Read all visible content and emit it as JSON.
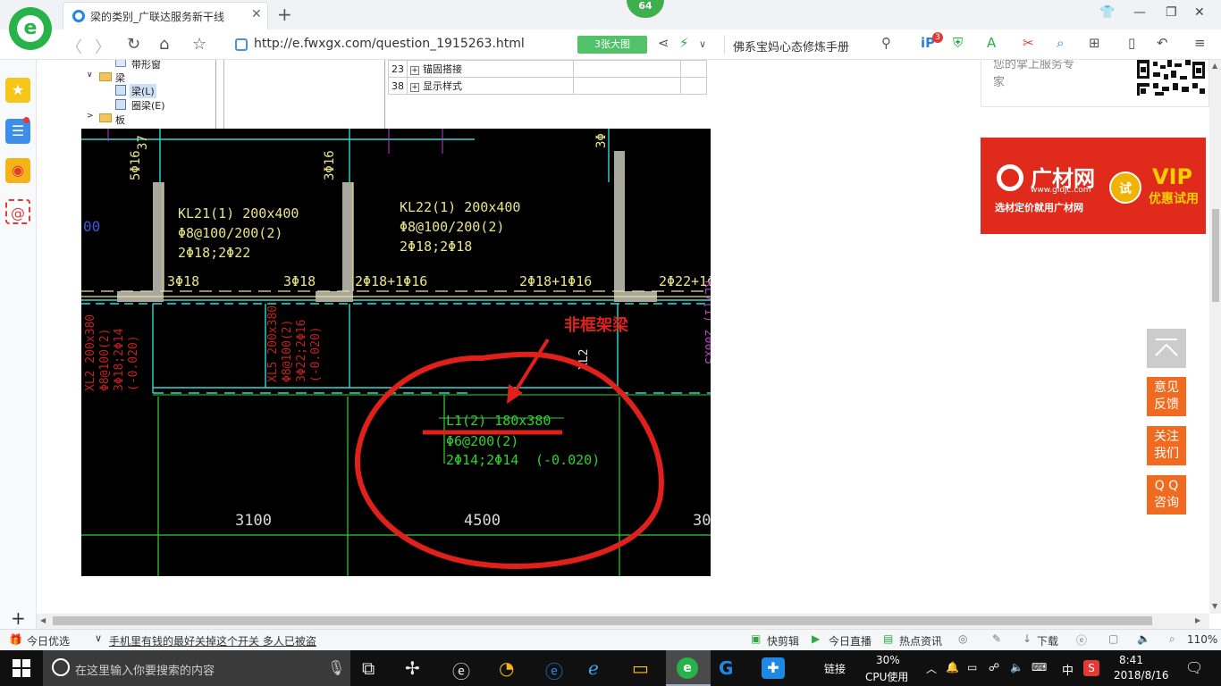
{
  "browser": {
    "tab_title": "梁的类别_广联达服务新干线",
    "tab_close": "✕",
    "new_tab": "+",
    "badge_count": "64",
    "url": "http://e.fwxgx.com/question_1915263.html",
    "big_pic_button": "3张大图",
    "search_text": "佛系宝妈心态修炼手册",
    "ext_badge": "3",
    "win_controls": [
      "⬜",
      "—",
      "❐",
      "✕"
    ]
  },
  "tree": {
    "items": [
      "带形窗",
      "梁",
      "梁(L)",
      "圈梁(E)",
      "板"
    ]
  },
  "prop_table": {
    "rows": [
      {
        "num": "23",
        "toggle": "+",
        "label": "锚固搭接"
      },
      {
        "num": "38",
        "toggle": "+",
        "label": "显示样式"
      }
    ]
  },
  "cad": {
    "annotation": "非框架梁",
    "col_label_left": "5Φ16",
    "col_label_mid": "3Φ16",
    "col_label_top": "3Φ",
    "top_partial_left": "37",
    "beam_kl21": [
      "KL21(1) 200x400",
      "Φ8@100/200(2)",
      "2Φ18;2Φ22"
    ],
    "beam_kl22": [
      "KL22(1) 200x400",
      "Φ8@100/200(2)",
      "2Φ18;2Φ18"
    ],
    "rebar_labels": [
      "3Φ18",
      "3Φ18",
      "2Φ18+1Φ16",
      "2Φ18+1Φ16",
      "2Φ22+1Φ"
    ],
    "xl2_left": [
      "XL2 200x380",
      "Φ8@100(2)",
      "3Φ18;2Φ14",
      "(-0.020)"
    ],
    "xl5": [
      "XL5 200x380",
      "Φ8@100(2)",
      "3Φ22;2Φ16",
      "(-0.020)"
    ],
    "xl2_right": "XL2",
    "xl7_partial": "KL7(1) 200x5",
    "left_partial": "00",
    "l1": [
      "L1(2) 180x380",
      "Φ6@200(2)",
      "2Φ14;2Φ14",
      "(-0.020)"
    ],
    "dims": [
      "3100",
      "4500",
      "30"
    ]
  },
  "right_column": {
    "ad_text": [
      "您的掌上服务专",
      "家"
    ],
    "banner": {
      "name": "广材网",
      "url": "www.gldjc.com",
      "subtitle": "选材定价就用广材网",
      "try": "试",
      "vip": "VIP",
      "vip_sub": "优惠试用"
    },
    "back_top": "︿",
    "buttons": [
      "意见\n反馈",
      "关注\n我们",
      "Q Q\n咨询"
    ]
  },
  "sidebar": {
    "plus": "+"
  },
  "status_bar": {
    "today": "今日优选",
    "news": "手机里有钱的最好关掉这个开关 多人已被盗",
    "items": [
      "快剪辑",
      "今日直播",
      "热点资讯",
      "下载"
    ],
    "zoom": "110%"
  },
  "taskbar": {
    "search_placeholder": "在这里输入你要搜索的内容",
    "link_label": "链接",
    "cpu_percent": "30%",
    "cpu_label": "CPU使用",
    "ime": "中",
    "time": "8:41",
    "date": "2018/8/16"
  },
  "colors": {
    "cad_bg": "#000000",
    "cad_yellow": "#e8e48a",
    "cad_green": "#2ed12e",
    "cad_red": "#c4221e",
    "cad_cyan": "#37d9d4",
    "cad_magenta": "#c23ec6",
    "annotation_red": "#e0201a",
    "accent_orange": "#f06a1f",
    "banner_red": "#e02b1c"
  }
}
